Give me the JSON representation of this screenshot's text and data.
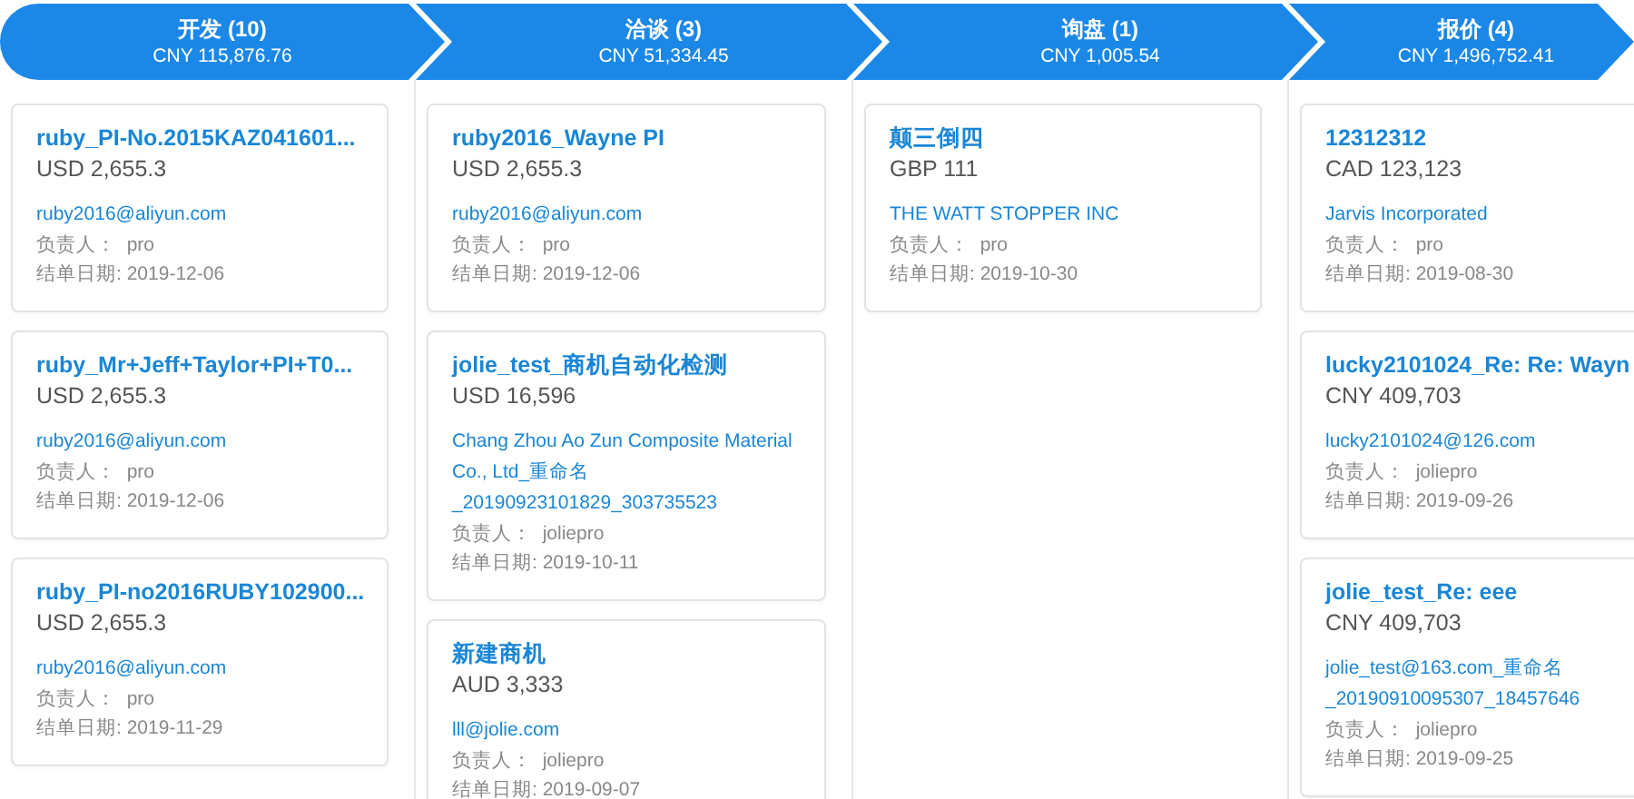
{
  "stages": [
    {
      "title": "开发 (10)",
      "total": "CNY 115,876.76",
      "cards": [
        {
          "title": "ruby_PI-No.2015KAZ041601...",
          "amount": "USD 2,655.3",
          "contact": "ruby2016@aliyun.com",
          "owner": "负责人：  pro",
          "close_date": "结单日期: 2019-12-06"
        },
        {
          "title": "ruby_Mr+Jeff+Taylor+PI+T0...",
          "amount": "USD 2,655.3",
          "contact": "ruby2016@aliyun.com",
          "owner": "负责人：  pro",
          "close_date": "结单日期: 2019-12-06"
        },
        {
          "title": "ruby_PI-no2016RUBY102900...",
          "amount": "USD 2,655.3",
          "contact": "ruby2016@aliyun.com",
          "owner": "负责人：  pro",
          "close_date": "结单日期: 2019-11-29"
        }
      ]
    },
    {
      "title": "洽谈 (3)",
      "total": "CNY 51,334.45",
      "cards": [
        {
          "title": "ruby2016_Wayne PI",
          "amount": "USD 2,655.3",
          "contact": "ruby2016@aliyun.com",
          "owner": "负责人：  pro",
          "close_date": "结单日期: 2019-12-06"
        },
        {
          "title": "jolie_test_商机自动化检测",
          "amount": "USD 16,596",
          "contact": "Chang Zhou Ao Zun Composite Material Co., Ltd_重命名 _20190923101829_303735523",
          "owner": "负责人：  joliepro",
          "close_date": "结单日期: 2019-10-11"
        },
        {
          "title": "新建商机",
          "amount": "AUD 3,333",
          "contact": "lll@jolie.com",
          "owner": "负责人：  joliepro",
          "close_date": "结单日期: 2019-09-07"
        }
      ]
    },
    {
      "title": "询盘 (1)",
      "total": "CNY 1,005.54",
      "cards": [
        {
          "title": "颠三倒四",
          "amount": "GBP 111",
          "contact": "THE WATT STOPPER INC",
          "owner": "负责人：  pro",
          "close_date": "结单日期: 2019-10-30"
        }
      ]
    },
    {
      "title": "报价 (4)",
      "total": "CNY 1,496,752.41",
      "cards": [
        {
          "title": "12312312",
          "amount": "CAD 123,123",
          "contact": "Jarvis Incorporated",
          "owner": "负责人：  pro",
          "close_date": "结单日期: 2019-08-30"
        },
        {
          "title": "lucky2101024_Re: Re: Wayn",
          "amount": "CNY 409,703",
          "contact": "lucky2101024@126.com",
          "owner": "负责人：  joliepro",
          "close_date": "结单日期: 2019-09-26"
        },
        {
          "title": "jolie_test_Re: eee",
          "amount": "CNY 409,703",
          "contact": "jolie_test@163.com_重命名 _20190910095307_18457646",
          "owner": "负责人：  joliepro",
          "close_date": "结单日期: 2019-09-25"
        }
      ]
    }
  ]
}
